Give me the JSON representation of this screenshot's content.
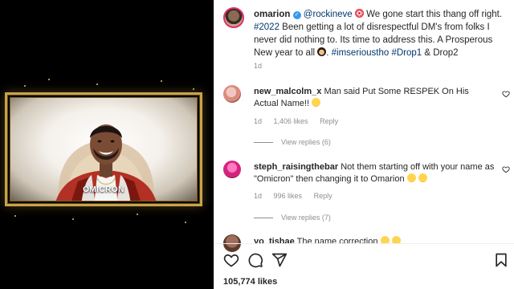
{
  "post": {
    "username": "omarion",
    "mention": "@rockineve",
    "caption_part1": " We gone start this thang off right. ",
    "caption_hashtag1": "#2022",
    "caption_part2": " Been getting a lot of disrespectful DM's from folks I never did nothing to. Its time to address this. A Prosperous New year to all ",
    "caption_hashtags2": "#imserioustho #Drop1",
    "caption_part3": " & Drop2",
    "time": "1d",
    "video_caption": "OMICRON"
  },
  "comments": [
    {
      "username": "new_malcolm_x",
      "text": "Man said Put Some RESPEK On His Actual Name!!",
      "time": "1d",
      "likes": "1,406 likes",
      "reply_label": "Reply",
      "view_replies": "View replies (6)"
    },
    {
      "username": "steph_raisingthebar",
      "text": "Not them starting off with your name as \"Omicron\" then changing it to Omarion",
      "time": "1d",
      "likes": "996 likes",
      "reply_label": "Reply",
      "view_replies": "View replies (7)"
    },
    {
      "username": "yo_tishae",
      "text": "The name correction"
    }
  ],
  "actions": {
    "like_icon": "heart-icon",
    "comment_icon": "comment-icon",
    "share_icon": "share-icon",
    "save_icon": "bookmark-icon"
  },
  "likes_count": "105,774 likes",
  "colors": {
    "link": "#00376b",
    "muted": "#8e8e8e",
    "text": "#262626",
    "frame_gold": "#c9a24a",
    "verified": "#3897f0"
  }
}
